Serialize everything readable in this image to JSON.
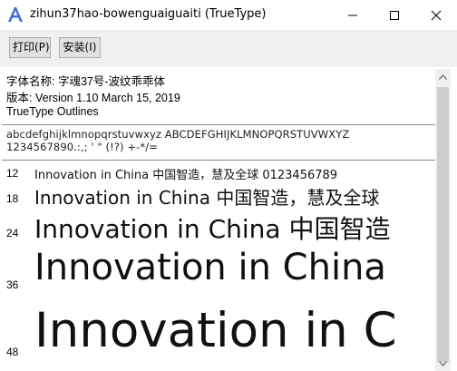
{
  "window": {
    "title": "zihun37hao-bowenguaiguaiti (TrueType)",
    "app_icon": "font-a-icon"
  },
  "toolbar": {
    "print_label": "打印(P)",
    "install_label": "安装(I)"
  },
  "font_info": {
    "name_line": "字体名称: 字魂37号-波纹乖乖体",
    "version_line": "版本: Version 1.10 March 15, 2019",
    "type_line": "TrueType Outlines"
  },
  "charset": {
    "line1": "abcdefghijklmnopqrstuvwxyz ABCDEFGHIJKLMNOPQRSTUVWXYZ",
    "line2": "1234567890.:,; ' \" (!?) +-*/="
  },
  "samples": [
    {
      "size": "12",
      "text": "Innovation in China 中国智造，慧及全球 0123456789"
    },
    {
      "size": "18",
      "text": "Innovation in China 中国智造，慧及全球"
    },
    {
      "size": "24",
      "text": "Innovation in China 中国智造"
    },
    {
      "size": "36",
      "text": "Innovation in China"
    },
    {
      "size": "48",
      "text": "Innovation in C"
    }
  ],
  "colors": {
    "accent_icon": "#3a6fd8",
    "toolbar_bg": "#f0f0f0"
  }
}
